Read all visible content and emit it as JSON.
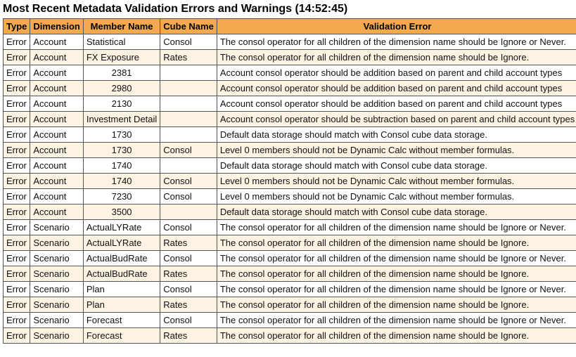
{
  "title": "Most Recent Metadata Validation Errors and Warnings (14:52:45)",
  "headers": {
    "type": "Type",
    "dimension": "Dimension",
    "member": "Member Name",
    "cube": "Cube Name",
    "error": "Validation Error"
  },
  "rows": [
    {
      "type": "Error",
      "dimension": "Account",
      "member": "Statistical",
      "cube": "Consol",
      "error": "The consol operator for all children of the dimension name should be Ignore or Never."
    },
    {
      "type": "Error",
      "dimension": "Account",
      "member": "FX Exposure",
      "cube": "Rates",
      "error": "The consol operator for all children of the dimension name should be Ignore."
    },
    {
      "type": "Error",
      "dimension": "Account",
      "member": "2381",
      "cube": "",
      "error": "Account consol operator should be addition based on parent and child account types"
    },
    {
      "type": "Error",
      "dimension": "Account",
      "member": "2980",
      "cube": "",
      "error": "Account consol operator should be addition based on parent and child account types"
    },
    {
      "type": "Error",
      "dimension": "Account",
      "member": "2130",
      "cube": "",
      "error": "Account consol operator should be addition based on parent and child account types"
    },
    {
      "type": "Error",
      "dimension": "Account",
      "member": "Investment Detail",
      "cube": "",
      "error": "Account consol operator should be subtraction based on parent and child account types"
    },
    {
      "type": "Error",
      "dimension": "Account",
      "member": "1730",
      "cube": "",
      "error": "Default data storage should match with Consol cube data storage."
    },
    {
      "type": "Error",
      "dimension": "Account",
      "member": "1730",
      "cube": "Consol",
      "error": "Level 0 members should not be Dynamic Calc without member formulas."
    },
    {
      "type": "Error",
      "dimension": "Account",
      "member": "1740",
      "cube": "",
      "error": "Default data storage should match with Consol cube data storage."
    },
    {
      "type": "Error",
      "dimension": "Account",
      "member": "1740",
      "cube": "Consol",
      "error": "Level 0 members should not be Dynamic Calc without member formulas."
    },
    {
      "type": "Error",
      "dimension": "Account",
      "member": "7230",
      "cube": "Consol",
      "error": "Level 0 members should not be Dynamic Calc without member formulas."
    },
    {
      "type": "Error",
      "dimension": "Account",
      "member": "3500",
      "cube": "",
      "error": "Default data storage should match with Consol cube data storage."
    },
    {
      "type": "Error",
      "dimension": "Scenario",
      "member": "ActualLYRate",
      "cube": "Consol",
      "error": "The consol operator for all children of the dimension name should be Ignore or Never."
    },
    {
      "type": "Error",
      "dimension": "Scenario",
      "member": "ActualLYRate",
      "cube": "Rates",
      "error": "The consol operator for all children of the dimension name should be Ignore."
    },
    {
      "type": "Error",
      "dimension": "Scenario",
      "member": "ActualBudRate",
      "cube": "Consol",
      "error": "The consol operator for all children of the dimension name should be Ignore or Never."
    },
    {
      "type": "Error",
      "dimension": "Scenario",
      "member": "ActualBudRate",
      "cube": "Rates",
      "error": "The consol operator for all children of the dimension name should be Ignore."
    },
    {
      "type": "Error",
      "dimension": "Scenario",
      "member": "Plan",
      "cube": "Consol",
      "error": "The consol operator for all children of the dimension name should be Ignore or Never."
    },
    {
      "type": "Error",
      "dimension": "Scenario",
      "member": "Plan",
      "cube": "Rates",
      "error": "The consol operator for all children of the dimension name should be Ignore."
    },
    {
      "type": "Error",
      "dimension": "Scenario",
      "member": "Forecast",
      "cube": "Consol",
      "error": "The consol operator for all children of the dimension name should be Ignore or Never."
    },
    {
      "type": "Error",
      "dimension": "Scenario",
      "member": "Forecast",
      "cube": "Rates",
      "error": "The consol operator for all children of the dimension name should be Ignore."
    }
  ]
}
